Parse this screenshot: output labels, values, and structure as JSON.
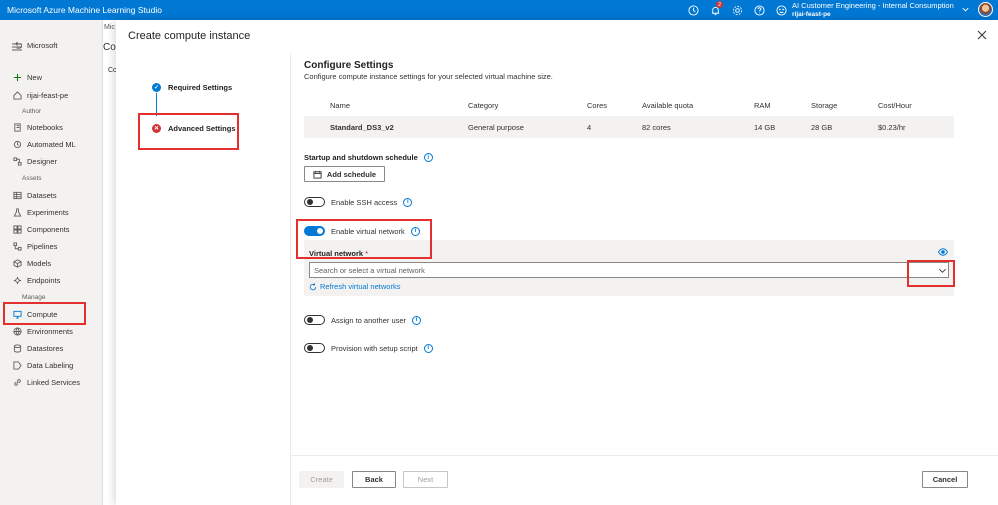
{
  "app": {
    "title": "Microsoft Azure Machine Learning Studio",
    "notification_count": "2",
    "account_name": "AI Customer Engineering - Internal Consumption",
    "workspace": "rijai-feast-pe"
  },
  "nav": {
    "back": "Microsoft",
    "new": "New",
    "workspace": "rijai-feast-pe",
    "section_author": "Author",
    "notebooks": "Notebooks",
    "automated_ml": "Automated ML",
    "designer": "Designer",
    "section_assets": "Assets",
    "datasets": "Datasets",
    "experiments": "Experiments",
    "components": "Components",
    "pipelines": "Pipelines",
    "models": "Models",
    "endpoints": "Endpoints",
    "section_manage": "Manage",
    "compute": "Compute",
    "environments": "Environments",
    "datastores": "Datastores",
    "data_labeling": "Data Labeling",
    "linked_services": "Linked Services"
  },
  "background": {
    "breadcrumb": "Mic",
    "title": "Co",
    "tab": "Co"
  },
  "dialog": {
    "title": "Create compute instance",
    "steps": [
      "Required Settings",
      "Advanced Settings"
    ],
    "heading": "Configure Settings",
    "subheading": "Configure compute instance settings for your selected virtual machine size.",
    "table": {
      "headers": [
        "Name",
        "Category",
        "Cores",
        "Available quota",
        "RAM",
        "Storage",
        "Cost/Hour"
      ],
      "row": [
        "Standard_DS3_v2",
        "General purpose",
        "4",
        "82 cores",
        "14 GB",
        "28 GB",
        "$0.23/hr"
      ]
    },
    "schedule_label": "Startup and shutdown schedule",
    "add_schedule": "Add schedule",
    "ssh_label": "Enable SSH access",
    "vnet_toggle_label": "Enable virtual network",
    "vnet_field_label": "Virtual network",
    "vnet_required": "*",
    "vnet_placeholder": "Search or select a virtual network",
    "refresh_link": "Refresh virtual networks",
    "assign_label": "Assign to another user",
    "provision_label": "Provision with setup script",
    "buttons": {
      "create": "Create",
      "back": "Back",
      "next": "Next",
      "cancel": "Cancel"
    },
    "toggles": {
      "ssh": false,
      "vnet": true,
      "assign": false,
      "provision": false
    }
  },
  "colors": {
    "topbar": "#0078d4",
    "accent": "#0078d4",
    "error": "#d13438",
    "highlight": "#e3302f"
  }
}
